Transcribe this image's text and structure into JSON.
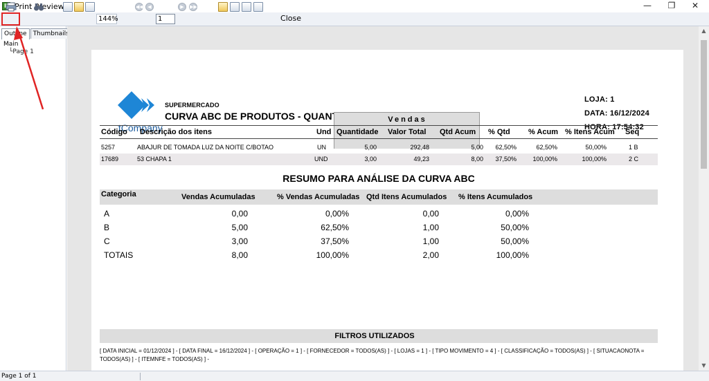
{
  "window": {
    "title": "Print Preview",
    "app_icon": "green-app-icon",
    "minimize": "—",
    "restore": "❐",
    "close": "✕"
  },
  "toolbar": {
    "zoom": "144%",
    "page_value": "1",
    "close_label": "Close"
  },
  "left_panel": {
    "tabs": [
      "Outline",
      "Thumbnails"
    ],
    "tree_root": "Main",
    "tree_child": "Page 1"
  },
  "status": {
    "page_info": "Page 1 of 1"
  },
  "report": {
    "logo_text": "NextCompany",
    "subtitle": "SUPERMERCADO",
    "title": "CURVA ABC DE PRODUTOS -   QUANTITATIVO",
    "loja": "LOJA:  1",
    "data": "DATA: 16/12/2024",
    "hora": "HORA: 17:54:32",
    "vendas_label": "Vendas",
    "columns": [
      "Código",
      "Descrição dos itens",
      "Und",
      "Quantidade",
      "Valor Total",
      "Qtd Acum",
      "% Qtd",
      "% Acum",
      "% Itens Acum",
      "Seq"
    ],
    "rows": [
      {
        "codigo": "5257",
        "descricao": "ABAJUR DE TOMADA  LUZ DA NOITE C/BOTAO",
        "und": "UN",
        "quantidade": "5,00",
        "valor_total": "292,48",
        "qtd_acum": "5,00",
        "pct_qtd": "62,50%",
        "pct_acum": "62,50%",
        "pct_itens": "50,00%",
        "seq": "1  B"
      },
      {
        "codigo": "17689",
        "descricao": "53 CHAPA 1",
        "und": "UND",
        "quantidade": "3,00",
        "valor_total": "49,23",
        "qtd_acum": "8,00",
        "pct_qtd": "37,50%",
        "pct_acum": "100,00%",
        "pct_itens": "100,00%",
        "seq": "2  C"
      }
    ],
    "resumo_title": "RESUMO PARA ANÁLISE DA CURVA ABC",
    "resumo_columns": [
      "Categoria",
      "Vendas Acumuladas",
      "% Vendas Acumuladas",
      "Qtd Itens Acumulados",
      "% Itens Acumulados"
    ],
    "resumo_rows": [
      {
        "cat": "A",
        "vendas": "0,00",
        "pct_vendas": "0,00%",
        "qtd_itens": "0,00",
        "pct_itens": "0,00%"
      },
      {
        "cat": "B",
        "vendas": "5,00",
        "pct_vendas": "62,50%",
        "qtd_itens": "1,00",
        "pct_itens": "50,00%"
      },
      {
        "cat": "C",
        "vendas": "3,00",
        "pct_vendas": "37,50%",
        "qtd_itens": "1,00",
        "pct_itens": "50,00%"
      },
      {
        "cat": "TOTAIS",
        "vendas": "8,00",
        "pct_vendas": "100,00%",
        "qtd_itens": "2,00",
        "pct_itens": "100,00%"
      }
    ],
    "filtros_title": "FILTROS UTILIZADOS",
    "filtros_text": "[ DATA INICIAL = 01/12/2024 ]  -  [ DATA FINAL = 16/12/2024 ]  -  [ OPERAÇÃO = 1 ]  -  [ FORNECEDOR = TODOS(AS) ]  -  [ LOJAS = 1 ]  -  [ TIPO MOVIMENTO = 4 ]  -  [ CLASSIFICAÇÃO = TODOS(AS) ]  -  [ SITUACAONOTA = TODOS(AS) ]  -  [ ITEMNFE = TODOS(AS) ]  -"
  },
  "colors": {
    "highlight": "#e02424",
    "header_fill": "#dddddd",
    "alt_row": "#ebe8ea",
    "logo_blue": "#1e86d6"
  }
}
